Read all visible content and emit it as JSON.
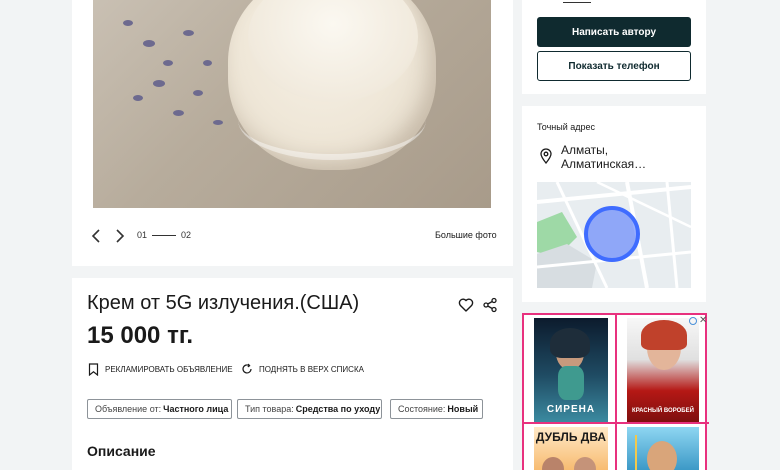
{
  "gallery": {
    "current": "01",
    "total": "02",
    "big_photo_label": "Большие фото"
  },
  "listing": {
    "title": "Крем от 5G излучения.(США)",
    "price": "15 000 тг.",
    "actions": {
      "promote": "РЕКЛАМИРОВАТЬ ОБЪЯВЛЕНИЕ",
      "raise": "ПОДНЯТЬ В ВЕРХ СПИСКА"
    },
    "tags": {
      "seller_label": "Объявление от:",
      "seller_value": "Частного лица",
      "type_label": "Тип товара:",
      "type_value": "Средства по уходу",
      "state_label": "Состояние:",
      "state_value": "Новый"
    },
    "description_heading": "Описание"
  },
  "contact": {
    "write_label": "Написать автору",
    "phone_label": "Показать телефон"
  },
  "address": {
    "label": "Точный адрес",
    "text": "Алматы, Алматинская…"
  },
  "ad": {
    "poster_1_title": "СИРЕНА",
    "poster_2_title": "КРАСНЫЙ ВОРОБЕЙ",
    "poster_3_title": "ДУБЛЬ ДВА"
  },
  "colors": {
    "primary": "#0f2a2f",
    "ad_border": "#e8317e",
    "map_marker": "#3f6cff"
  },
  "icons": [
    "chevron-left-icon",
    "chevron-right-icon",
    "heart-icon",
    "share-icon",
    "bookmark-icon",
    "refresh-icon",
    "location-pin-icon",
    "ad-info-icon",
    "close-icon"
  ]
}
